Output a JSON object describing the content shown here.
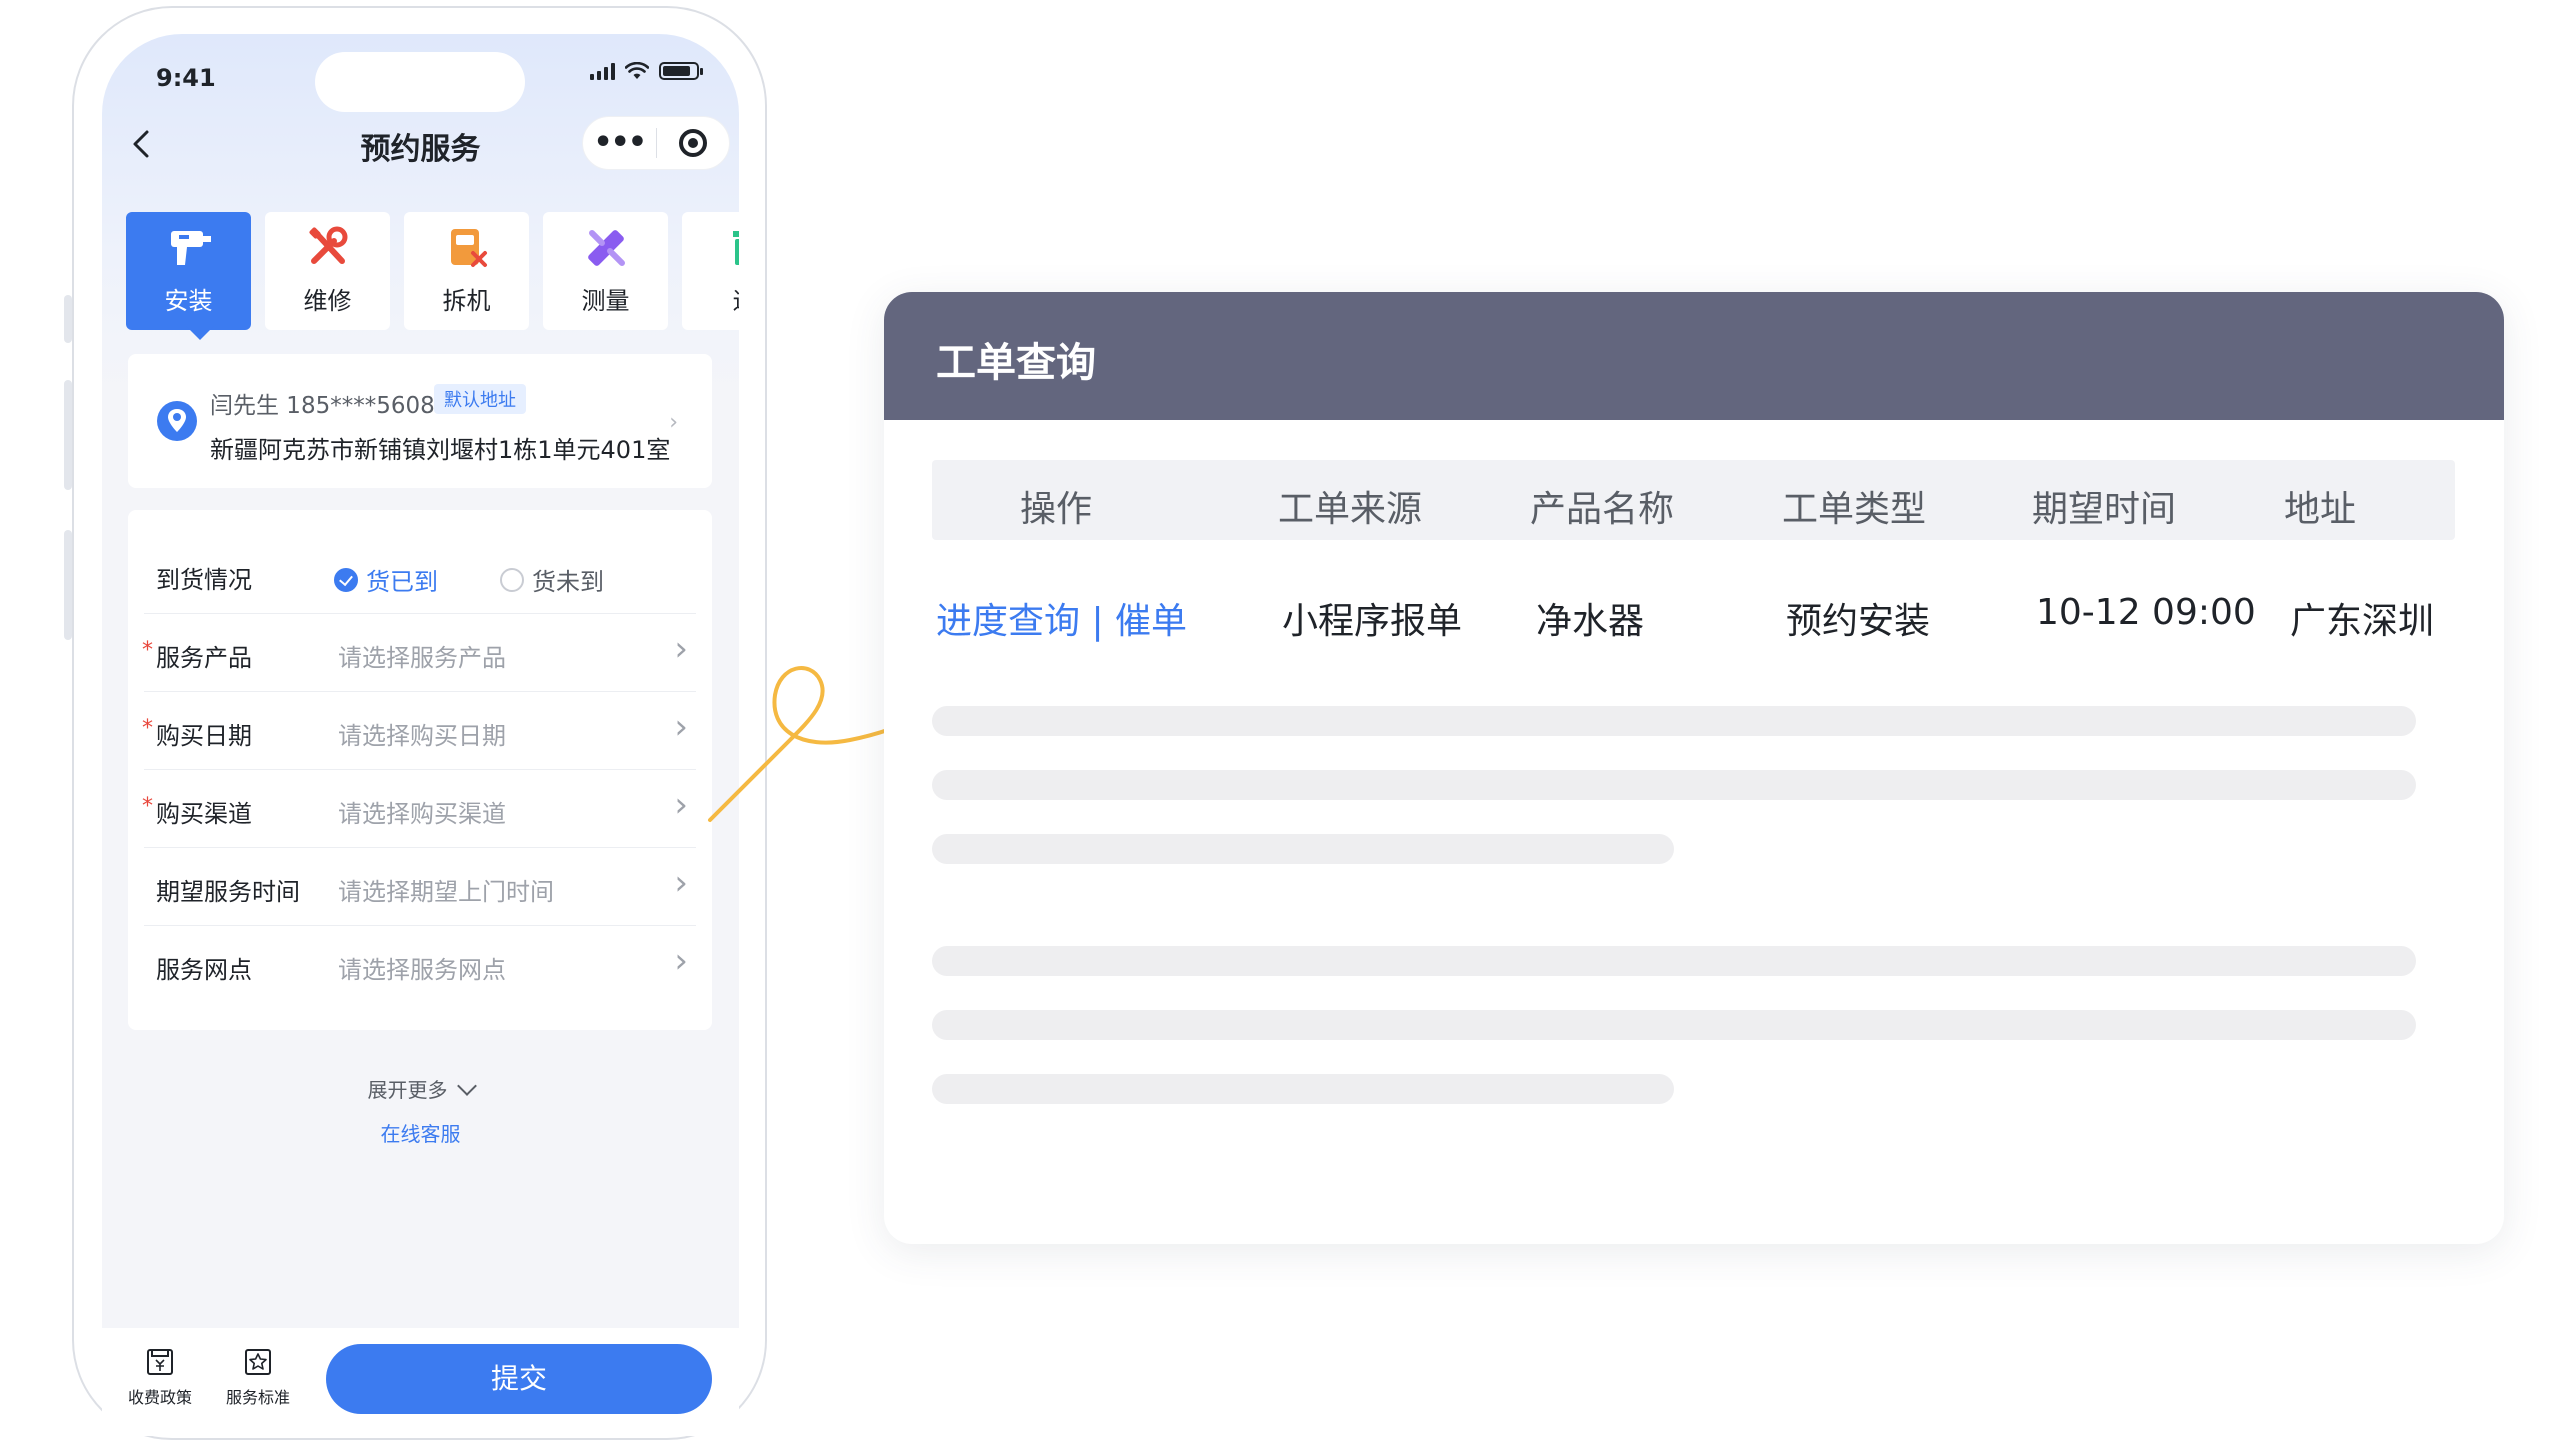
{
  "status_bar": {
    "time": "9:41"
  },
  "nav": {
    "title": "预约服务",
    "back_icon": "chevron-left-icon",
    "more_icon": "more-dots-icon",
    "close_icon": "target-close-icon"
  },
  "service_tabs": [
    {
      "label": "安装",
      "icon": "drill-icon",
      "color": "#ffffff",
      "active": true
    },
    {
      "label": "维修",
      "icon": "tools-icon",
      "color": "#e84a3c",
      "active": false
    },
    {
      "label": "拆机",
      "icon": "dismantle-icon",
      "color": "#f29a3c",
      "active": false
    },
    {
      "label": "测量",
      "icon": "ruler-pencil-icon",
      "color": "#8a5cf0",
      "active": false
    },
    {
      "label": "退",
      "icon": "bin-icon",
      "color": "#2bc48a",
      "active": false
    }
  ],
  "address": {
    "name_phone": "闫先生 185****5608",
    "tag": "默认地址",
    "detail": "新疆阿克苏市新铺镇刘堰村1栋1单元401室"
  },
  "form": {
    "arrival": {
      "label": "到货情况",
      "option_on": "货已到",
      "option_off": "货未到"
    },
    "rows": [
      {
        "label": "服务产品",
        "placeholder": "请选择服务产品",
        "required": true
      },
      {
        "label": "购买日期",
        "placeholder": "请选择购买日期",
        "required": true
      },
      {
        "label": "购买渠道",
        "placeholder": "请选择购买渠道",
        "required": true
      },
      {
        "label": "期望服务时间",
        "placeholder": "请选择期望上门时间",
        "required": false
      },
      {
        "label": "服务网点",
        "placeholder": "请选择服务网点",
        "required": false
      }
    ],
    "required_mark": "*"
  },
  "expand_more": "展开更多",
  "online_service": "在线客服",
  "bottom_bar": {
    "fee_policy": "收费政策",
    "service_standard": "服务标准",
    "submit": "提交"
  },
  "panel": {
    "title": "工单查询",
    "headers": [
      "操作",
      "工单来源",
      "产品名称",
      "工单类型",
      "期望时间",
      "地址"
    ],
    "row": {
      "action": "进度查询 | 催单",
      "source": "小程序报单",
      "product": "净水器",
      "type": "预约安装",
      "time": "10-12 09:00",
      "address": "广东深圳"
    }
  },
  "colors": {
    "accent": "#3c7bf0",
    "panel_header": "#63667e",
    "arrow": "#f5b942",
    "required": "#e8473c"
  }
}
